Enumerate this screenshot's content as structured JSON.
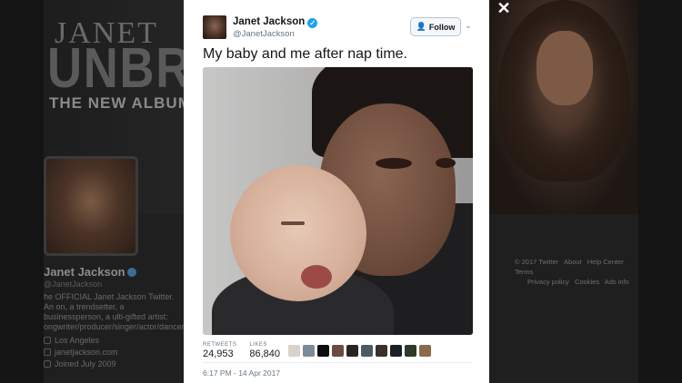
{
  "background": {
    "banner_name": "JANET",
    "banner_album": "UNBRE",
    "banner_tagline": "THE NEW ALBUM AVA",
    "profile_name": "Janet Jackson",
    "profile_handle": "@JanetJackson",
    "profile_bio": "he OFFICIAL Janet Jackson Twitter. An on, a trendsetter, a businessperson, a ulti-gifted artist: ongwriter/producer/singer/actor/dancer.",
    "location": "Los Angeles",
    "website": "janetjackson.com",
    "joined": "Joined July 2009",
    "footer": {
      "copyright": "© 2017 Twitter",
      "about": "About",
      "help": "Help Center",
      "terms": "Terms",
      "privacy": "Privacy policy",
      "cookies": "Cookies",
      "ads": "Ads info"
    }
  },
  "close": "✕",
  "tweet": {
    "author_name": "Janet Jackson",
    "author_handle": "@JanetJackson",
    "verified_icon": "✓",
    "follow_label": "Follow",
    "follow_icon": "👤",
    "caret_icon": "⌄",
    "text": "My baby and me after nap time.",
    "retweets_label": "RETWEETS",
    "retweets": "24,953",
    "likes_label": "LIKES",
    "likes": "86,840",
    "timestamp": "6:17 PM - 14 Apr 2017",
    "liker_colors": [
      "#d9d2cc",
      "#7b8a96",
      "#0d0d0d",
      "#6d4b45",
      "#2a2420",
      "#4a5b66",
      "#3a302c",
      "#1c1f26",
      "#2f3a2a",
      "#8a6a4a"
    ]
  }
}
